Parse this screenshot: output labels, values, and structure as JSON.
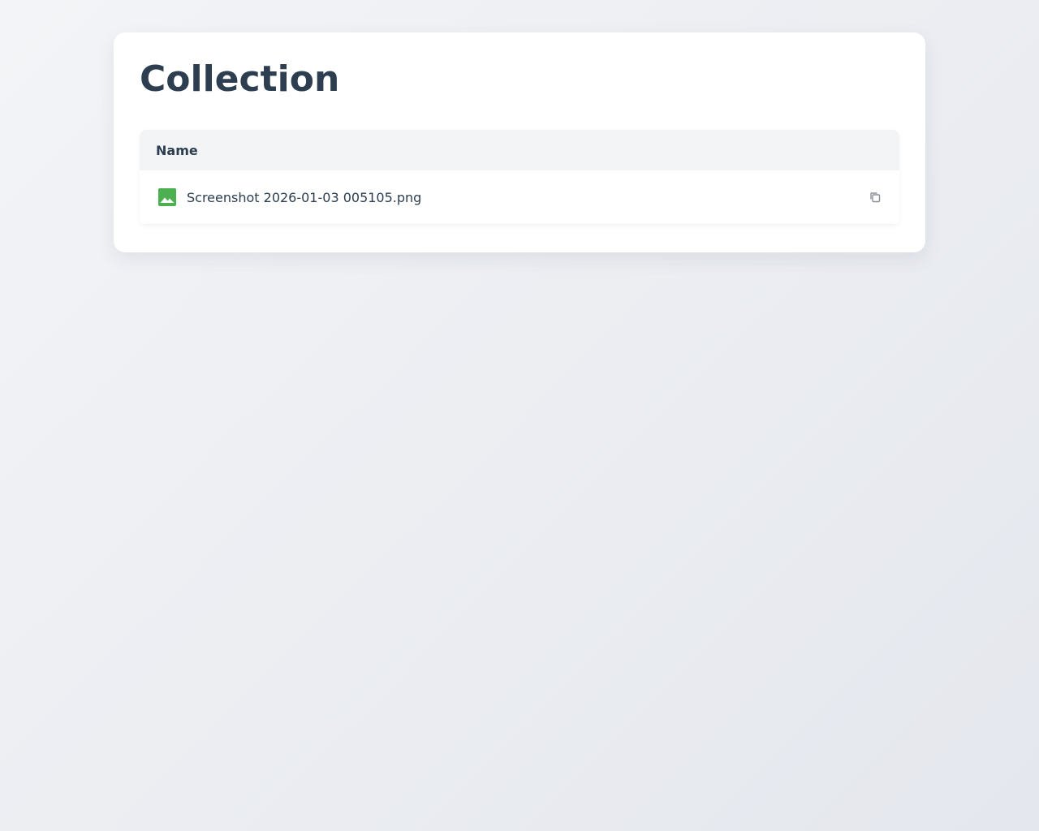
{
  "page": {
    "title": "Collection"
  },
  "table": {
    "header": {
      "name_label": "Name"
    },
    "rows": [
      {
        "icon": "image-icon",
        "name": "Screenshot 2026-01-03 005105.png",
        "action_icon": "copy-icon"
      }
    ]
  },
  "colors": {
    "title": "#2c3e50",
    "image_icon": "#4caf50",
    "header_bg": "#f2f4f6",
    "copy_icon": "#8a9099"
  }
}
